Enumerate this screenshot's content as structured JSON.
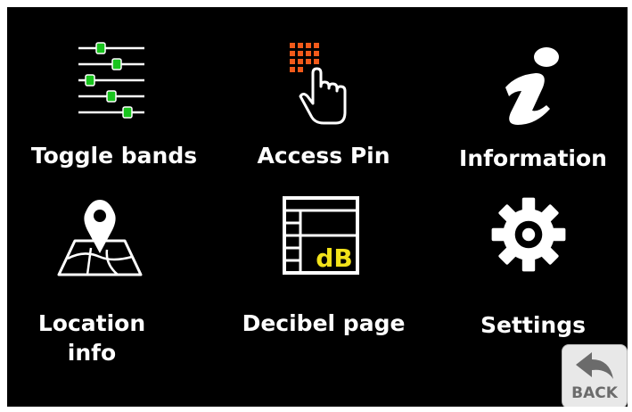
{
  "menu": {
    "toggle_bands": {
      "label": "Toggle bands",
      "icon": "equalizer-sliders-icon"
    },
    "access_pin": {
      "label": "Access Pin",
      "icon": "keypad-pointer-icon"
    },
    "information": {
      "label": "Information",
      "icon": "information-icon"
    },
    "location_info": {
      "label_line1": "Location",
      "label_line2": "info",
      "icon": "map-pin-icon"
    },
    "decibel_page": {
      "label": "Decibel page",
      "icon": "decibel-table-icon",
      "icon_text": "dB"
    },
    "settings": {
      "label": "Settings",
      "icon": "gear-icon"
    }
  },
  "back": {
    "label": "BACK",
    "icon": "back-arrow-icon"
  },
  "colors": {
    "background": "#000000",
    "text": "#ffffff",
    "slider_knob": "#19c41e",
    "keypad": "#f25a1a",
    "db_highlight": "#f2e21a"
  }
}
